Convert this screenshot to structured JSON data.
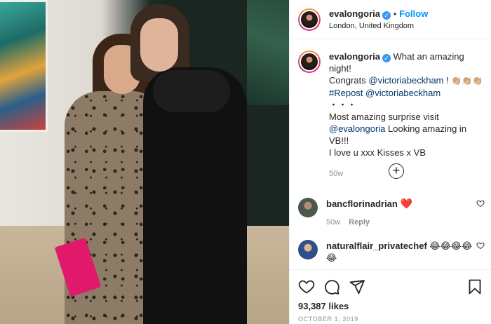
{
  "post": {
    "username": "evalongoria",
    "follow_label": "Follow",
    "location": "London, United Kingdom",
    "verified_mark": "✓",
    "separator": "•"
  },
  "caption": {
    "username": "evalongoria",
    "line1": "What an amazing night!",
    "line2_prefix": "Congrats ",
    "mention1": "@victoriabeckham",
    "line2_suffix": " ! ",
    "claps": "👏🏼👏🏼👏🏼",
    "hashtag": "#Repost",
    "mention2": "@victoriabeckham",
    "dots": "・・・",
    "line4": "Most amazing surprise visit",
    "mention3": "@evalongoria",
    "line5_suffix": " Looking amazing in VB!!!",
    "line6": "I love u xxx Kisses x VB",
    "time": "50w"
  },
  "more_comments_icon": "plus-circle-icon",
  "comments": [
    {
      "username": "bancflorinadrian",
      "text": "❤️",
      "time": "50w",
      "reply_label": "Reply"
    },
    {
      "username": "naturalflair_privatechef",
      "text": "😂😂😂😂",
      "text2": "😂"
    }
  ],
  "actions": {
    "like_icon": "heart-icon",
    "comment_icon": "comment-icon",
    "share_icon": "paper-plane-icon",
    "save_icon": "bookmark-icon"
  },
  "likes": "93,387 likes",
  "date": "OCTOBER 1, 2019",
  "colors": {
    "link": "#0095f6",
    "mention": "#00376b",
    "secondary_text": "#8e8e8e",
    "heart": "#ed4956",
    "verified": "#3897f0"
  }
}
